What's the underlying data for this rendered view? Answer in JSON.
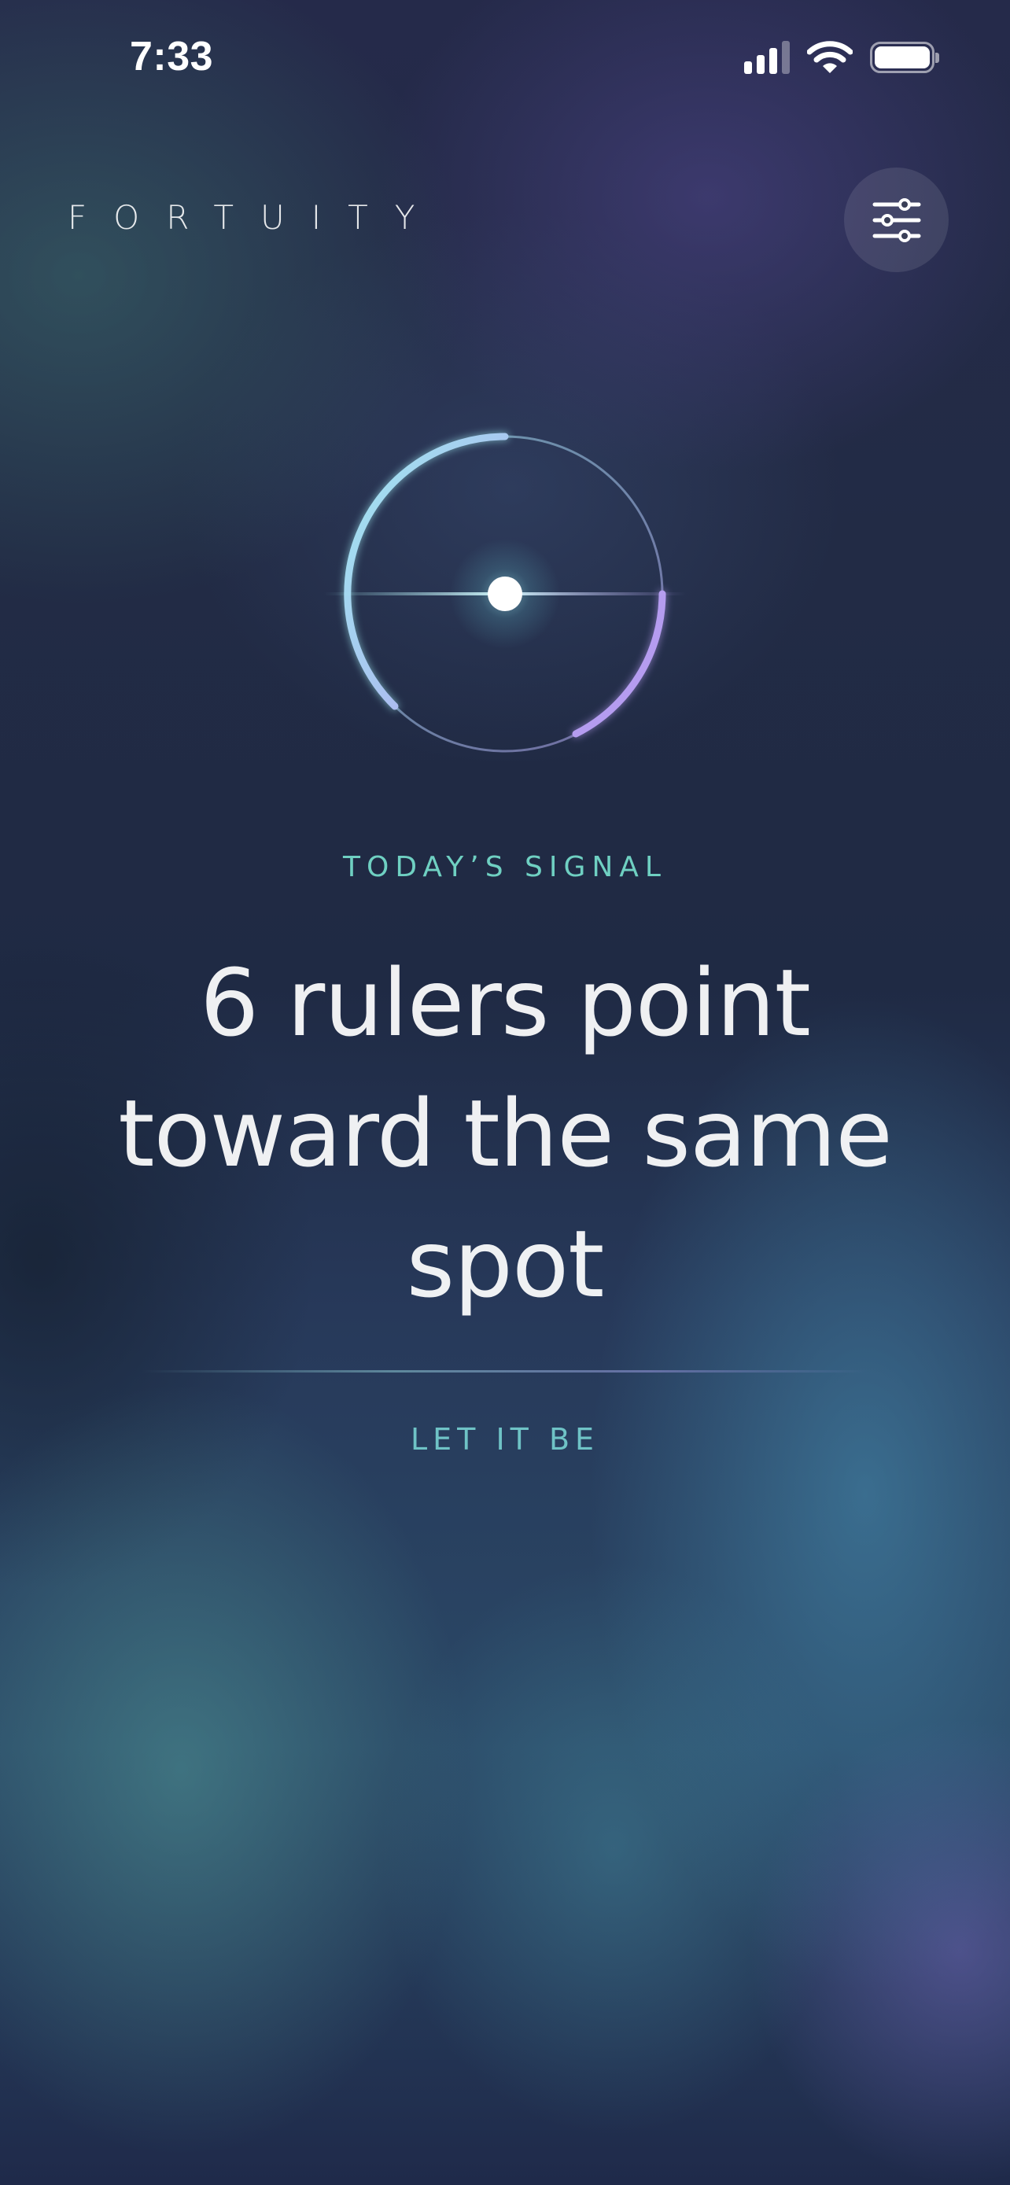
{
  "status_bar": {
    "time": "7:33",
    "signal_icon": "cellular-signal-icon",
    "wifi_icon": "wifi-icon",
    "battery_icon": "battery-icon"
  },
  "header": {
    "brand": "FORTUITY",
    "settings_icon": "sliders-icon"
  },
  "dial": {
    "icon": "signal-dial-icon",
    "colors": {
      "cyan": "#9fe8ef",
      "violet": "#b59cf0",
      "core": "#ffffff"
    }
  },
  "content": {
    "label": "TODAY’S SIGNAL",
    "headline": "6 rulers point toward the same spot",
    "action": "LET IT BE"
  },
  "colors": {
    "accent": "#6fd0c2",
    "action": "#6fc3c6"
  }
}
